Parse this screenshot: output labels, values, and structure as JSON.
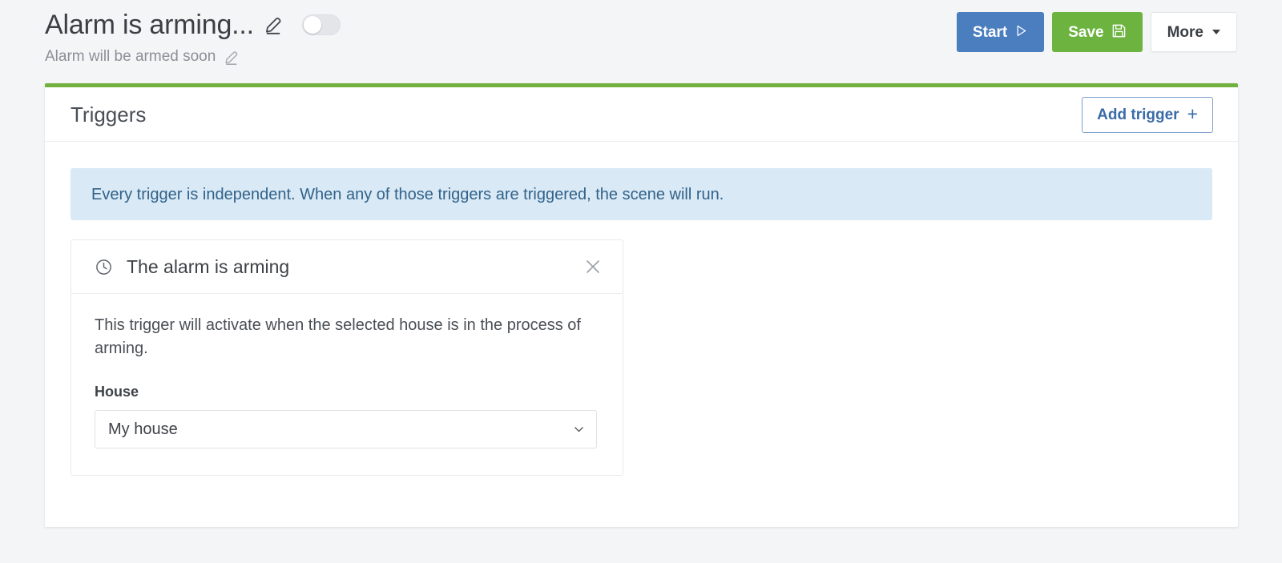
{
  "header": {
    "title": "Alarm is arming...",
    "title_edit_icon": "pencil-icon",
    "subtitle": "Alarm will be armed soon",
    "subtitle_edit_icon": "pencil-icon",
    "enabled_toggle": {
      "state": "off",
      "label": "scene-enabled-toggle"
    },
    "buttons": {
      "start": "Start",
      "start_icon": "play-icon",
      "save": "Save",
      "save_icon": "floppy-disk-icon",
      "more": "More",
      "more_icon": "caret-down-icon"
    }
  },
  "card": {
    "accent_color": "#73b13f",
    "title": "Triggers",
    "add_trigger_label": "Add trigger",
    "add_trigger_icon": "plus-icon",
    "info_banner": "Every trigger is independent. When any of those triggers are triggered, the scene will run.",
    "trigger": {
      "icon": "clock-icon",
      "title": "The alarm is arming",
      "close_icon": "close-icon",
      "description": "This trigger will activate when the selected house is in the process of arming.",
      "field": {
        "label": "House",
        "value": "My house",
        "chevron_icon": "chevron-down-icon"
      }
    }
  },
  "colors": {
    "page_background": "#f4f5f7",
    "primary_blue": "#4a7ebf",
    "success_green": "#6cb33f",
    "accent_green": "#73b13f",
    "info_background": "#d9e9f5",
    "info_text": "#31628a",
    "link_blue": "#3a6ba8"
  }
}
